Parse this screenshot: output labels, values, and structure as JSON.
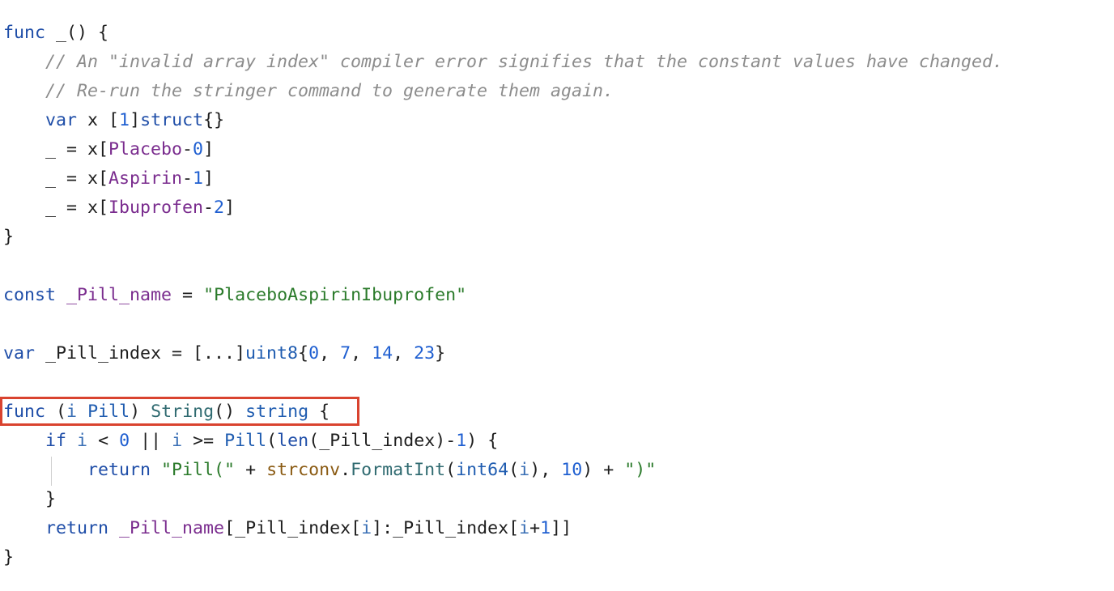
{
  "editor": {
    "colors": {
      "keyword": "#1f4ea8",
      "number": "#1f5fd1",
      "constant": "#7a2c8e",
      "string": "#2a7a2a",
      "function": "#2f6a70",
      "package": "#8a5a12",
      "comment": "#8c8c8c",
      "highlight_border": "#d9432f"
    },
    "lines": [
      {
        "tokens": [
          {
            "t": "func",
            "c": "kw"
          },
          {
            "t": " _() {",
            "c": "plain"
          }
        ]
      },
      {
        "tokens": [
          {
            "t": "    // An \"invalid array index\" compiler error signifies that the constant values have changed.",
            "c": "cmt"
          }
        ]
      },
      {
        "tokens": [
          {
            "t": "    // Re-run the stringer command to generate them again.",
            "c": "cmt"
          }
        ]
      },
      {
        "tokens": [
          {
            "t": "    ",
            "c": "plain"
          },
          {
            "t": "var",
            "c": "kw"
          },
          {
            "t": " x [",
            "c": "plain"
          },
          {
            "t": "1",
            "c": "num"
          },
          {
            "t": "]",
            "c": "plain"
          },
          {
            "t": "struct",
            "c": "kw"
          },
          {
            "t": "{}",
            "c": "plain"
          }
        ]
      },
      {
        "tokens": [
          {
            "t": "    _ = x[",
            "c": "plain"
          },
          {
            "t": "Placebo",
            "c": "cn"
          },
          {
            "t": "-",
            "c": "plain"
          },
          {
            "t": "0",
            "c": "num"
          },
          {
            "t": "]",
            "c": "plain"
          }
        ]
      },
      {
        "tokens": [
          {
            "t": "    _ = x[",
            "c": "plain"
          },
          {
            "t": "Aspirin",
            "c": "cn"
          },
          {
            "t": "-",
            "c": "plain"
          },
          {
            "t": "1",
            "c": "num"
          },
          {
            "t": "]",
            "c": "plain"
          }
        ]
      },
      {
        "tokens": [
          {
            "t": "    _ = x[",
            "c": "plain"
          },
          {
            "t": "Ibuprofen",
            "c": "cn"
          },
          {
            "t": "-",
            "c": "plain"
          },
          {
            "t": "2",
            "c": "num"
          },
          {
            "t": "]",
            "c": "plain"
          }
        ]
      },
      {
        "tokens": [
          {
            "t": "}",
            "c": "plain"
          }
        ]
      },
      {
        "tokens": []
      },
      {
        "tokens": [
          {
            "t": "const",
            "c": "kw"
          },
          {
            "t": " ",
            "c": "plain"
          },
          {
            "t": "_Pill_name",
            "c": "cn"
          },
          {
            "t": " = ",
            "c": "plain"
          },
          {
            "t": "\"PlaceboAspirinIbuprofen\"",
            "c": "str"
          }
        ]
      },
      {
        "tokens": []
      },
      {
        "tokens": [
          {
            "t": "var",
            "c": "kw"
          },
          {
            "t": " _Pill_index = [...]",
            "c": "plain"
          },
          {
            "t": "uint8",
            "c": "typ"
          },
          {
            "t": "{",
            "c": "plain"
          },
          {
            "t": "0",
            "c": "num"
          },
          {
            "t": ", ",
            "c": "plain"
          },
          {
            "t": "7",
            "c": "num"
          },
          {
            "t": ", ",
            "c": "plain"
          },
          {
            "t": "14",
            "c": "num"
          },
          {
            "t": ", ",
            "c": "plain"
          },
          {
            "t": "23",
            "c": "num"
          },
          {
            "t": "}",
            "c": "plain"
          }
        ]
      },
      {
        "tokens": []
      },
      {
        "tokens": [
          {
            "t": "func",
            "c": "kw"
          },
          {
            "t": " (",
            "c": "plain"
          },
          {
            "t": "i",
            "c": "par"
          },
          {
            "t": " ",
            "c": "plain"
          },
          {
            "t": "Pill",
            "c": "typ"
          },
          {
            "t": ") ",
            "c": "plain"
          },
          {
            "t": "String",
            "c": "fn"
          },
          {
            "t": "() ",
            "c": "plain"
          },
          {
            "t": "string",
            "c": "typ"
          },
          {
            "t": " {",
            "c": "plain"
          }
        ]
      },
      {
        "tokens": [
          {
            "t": "    ",
            "c": "plain"
          },
          {
            "t": "if",
            "c": "kw"
          },
          {
            "t": " ",
            "c": "plain"
          },
          {
            "t": "i",
            "c": "par"
          },
          {
            "t": " < ",
            "c": "plain"
          },
          {
            "t": "0",
            "c": "num"
          },
          {
            "t": " || ",
            "c": "plain"
          },
          {
            "t": "i",
            "c": "par"
          },
          {
            "t": " >= ",
            "c": "plain"
          },
          {
            "t": "Pill",
            "c": "typ"
          },
          {
            "t": "(",
            "c": "plain"
          },
          {
            "t": "len",
            "c": "kw"
          },
          {
            "t": "(_Pill_index)-",
            "c": "plain"
          },
          {
            "t": "1",
            "c": "num"
          },
          {
            "t": ") {",
            "c": "plain"
          }
        ]
      },
      {
        "tokens": [
          {
            "t": "        ",
            "c": "plain"
          },
          {
            "t": "return",
            "c": "kw"
          },
          {
            "t": " ",
            "c": "plain"
          },
          {
            "t": "\"Pill(\"",
            "c": "str"
          },
          {
            "t": " + ",
            "c": "plain"
          },
          {
            "t": "strconv",
            "c": "pkg"
          },
          {
            "t": ".",
            "c": "plain"
          },
          {
            "t": "FormatInt",
            "c": "fn"
          },
          {
            "t": "(",
            "c": "plain"
          },
          {
            "t": "int64",
            "c": "typ"
          },
          {
            "t": "(",
            "c": "plain"
          },
          {
            "t": "i",
            "c": "par"
          },
          {
            "t": "), ",
            "c": "plain"
          },
          {
            "t": "10",
            "c": "num"
          },
          {
            "t": ") + ",
            "c": "plain"
          },
          {
            "t": "\")\"",
            "c": "str"
          }
        ]
      },
      {
        "tokens": [
          {
            "t": "    }",
            "c": "plain"
          }
        ]
      },
      {
        "tokens": [
          {
            "t": "    ",
            "c": "plain"
          },
          {
            "t": "return",
            "c": "kw"
          },
          {
            "t": " ",
            "c": "plain"
          },
          {
            "t": "_Pill_name",
            "c": "cn"
          },
          {
            "t": "[_Pill_index[",
            "c": "plain"
          },
          {
            "t": "i",
            "c": "par"
          },
          {
            "t": "]:_Pill_index[",
            "c": "plain"
          },
          {
            "t": "i",
            "c": "par"
          },
          {
            "t": "+",
            "c": "plain"
          },
          {
            "t": "1",
            "c": "num"
          },
          {
            "t": "]]",
            "c": "plain"
          }
        ]
      },
      {
        "tokens": [
          {
            "t": "}",
            "c": "plain"
          }
        ]
      }
    ]
  }
}
